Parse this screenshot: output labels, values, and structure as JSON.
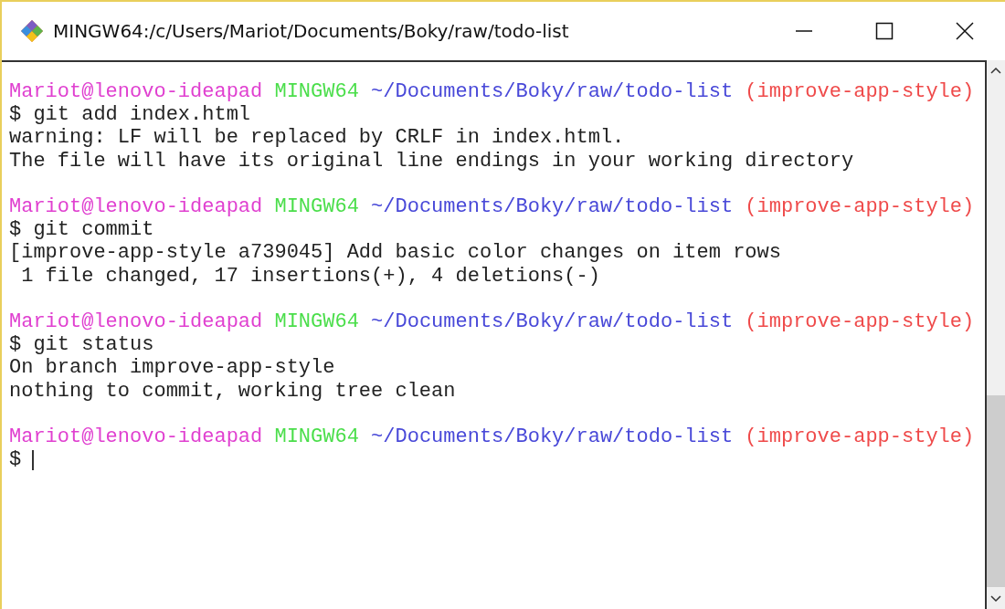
{
  "window": {
    "title": "MINGW64:/c/Users/Mariot/Documents/Boky/raw/todo-list"
  },
  "terminal": {
    "blocks": [
      {
        "prompt": {
          "user": "Mariot@lenovo-ideapad",
          "host": "MINGW64",
          "path": "~/Documents/Boky/raw/todo-list",
          "branch": "(improve-app-style)"
        },
        "lines": [
          {
            "kind": "command",
            "text": "$ git add index.html"
          },
          {
            "kind": "output",
            "text": "warning: LF will be replaced by CRLF in index.html."
          },
          {
            "kind": "output",
            "text": "The file will have its original line endings in your working directory"
          }
        ]
      },
      {
        "prompt": {
          "user": "Mariot@lenovo-ideapad",
          "host": "MINGW64",
          "path": "~/Documents/Boky/raw/todo-list",
          "branch": "(improve-app-style)"
        },
        "lines": [
          {
            "kind": "command",
            "text": "$ git commit"
          },
          {
            "kind": "output",
            "text": "[improve-app-style a739045] Add basic color changes on item rows"
          },
          {
            "kind": "output",
            "text": " 1 file changed, 17 insertions(+), 4 deletions(-)"
          }
        ]
      },
      {
        "prompt": {
          "user": "Mariot@lenovo-ideapad",
          "host": "MINGW64",
          "path": "~/Documents/Boky/raw/todo-list",
          "branch": "(improve-app-style)"
        },
        "lines": [
          {
            "kind": "command",
            "text": "$ git status"
          },
          {
            "kind": "output",
            "text": "On branch improve-app-style"
          },
          {
            "kind": "output",
            "text": "nothing to commit, working tree clean"
          }
        ]
      },
      {
        "prompt": {
          "user": "Mariot@lenovo-ideapad",
          "host": "MINGW64",
          "path": "~/Documents/Boky/raw/todo-list",
          "branch": "(improve-app-style)"
        },
        "lines": [
          {
            "kind": "input",
            "text": "$"
          }
        ]
      }
    ]
  }
}
